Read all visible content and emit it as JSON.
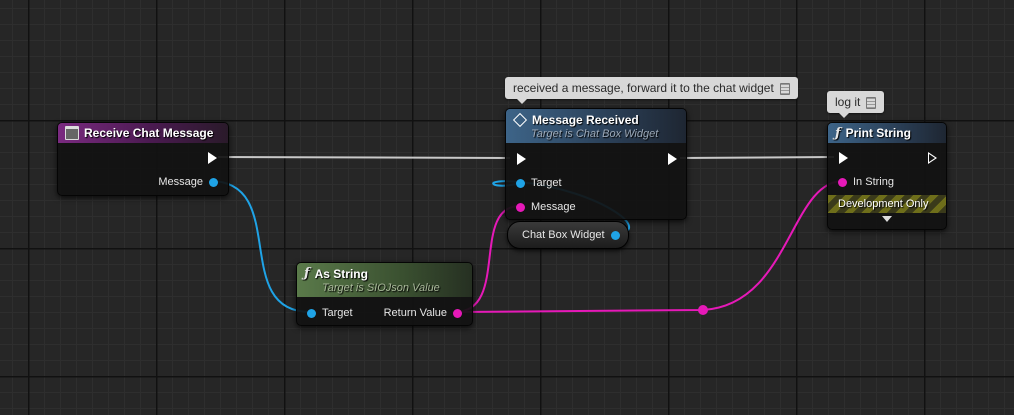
{
  "comments": {
    "message_received": "received a message, forward it to the chat widget",
    "print_string": "log it"
  },
  "nodes": {
    "receive_chat_message": {
      "title": "Receive Chat Message",
      "pins": {
        "message": "Message"
      }
    },
    "message_received": {
      "title": "Message Received",
      "subtitle": "Target is Chat Box Widget",
      "pins": {
        "target": "Target",
        "message": "Message"
      }
    },
    "print_string": {
      "title": "Print String",
      "pins": {
        "in_string": "In String"
      },
      "dev_only": "Development Only"
    },
    "as_string": {
      "title": "As String",
      "subtitle": "Target is SIOJson Value",
      "pins": {
        "target": "Target",
        "return_value": "Return Value"
      }
    },
    "chat_box_widget": {
      "label": "Chat Box Widget"
    }
  },
  "icons": {
    "event": "event-icon",
    "function": "function-icon",
    "interface_event": "diamond-icon"
  },
  "colors": {
    "object_pin": "#1fa3e6",
    "string_pin": "#e619b8",
    "exec_wire": "#ffffff",
    "event_header": "#7a2a80",
    "function_header": "#3d6488",
    "pure_header": "#5a7a4a"
  }
}
